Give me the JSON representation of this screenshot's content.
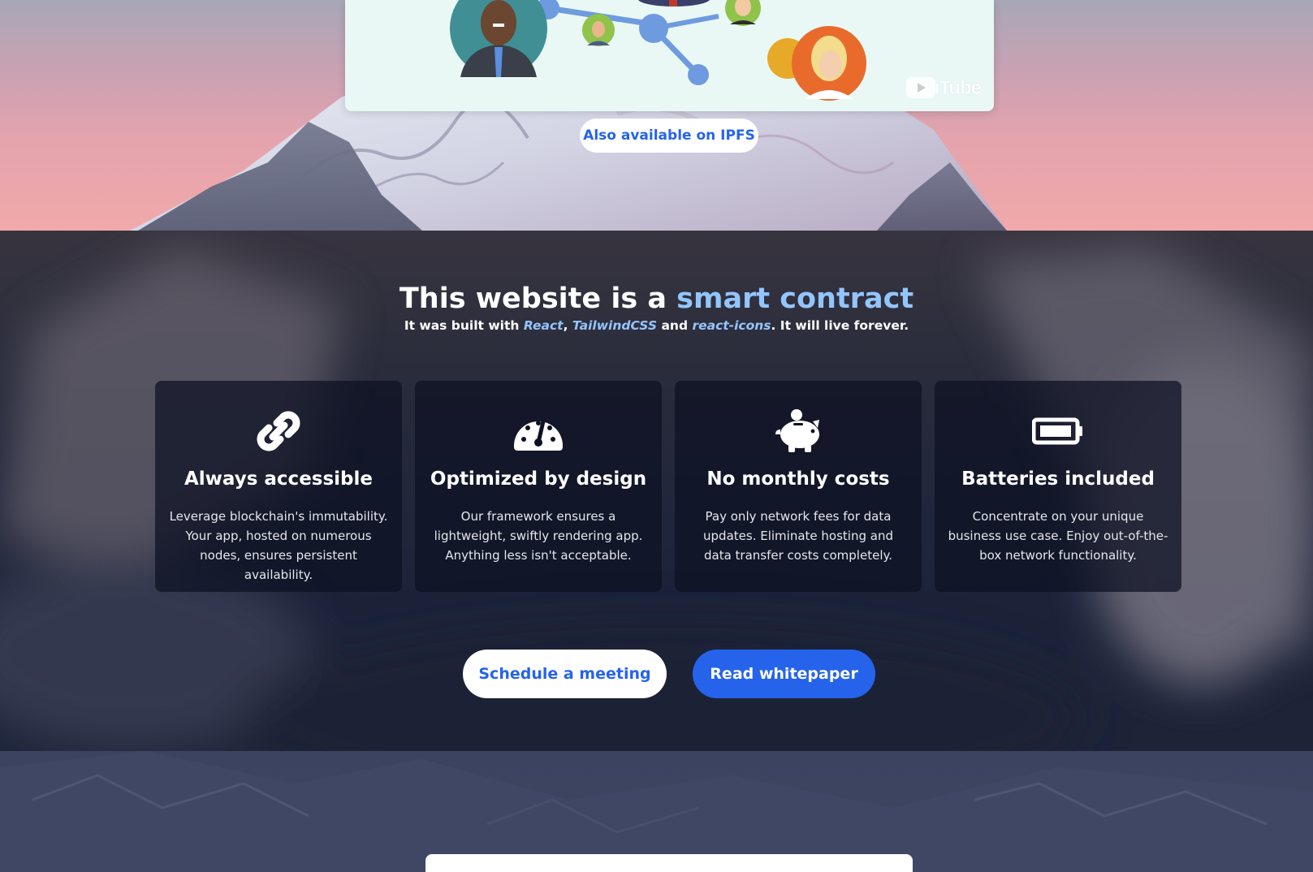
{
  "video": {
    "logo_text": "YouTube",
    "colors": {
      "background": "#e9f8f5",
      "node": "#6e9bdf"
    }
  },
  "hero": {
    "ipfs_label": "Also available on IPFS"
  },
  "band": {
    "title_prefix": "This website is a ",
    "title_accent": "smart contract",
    "subtitle_prefix": "It was built with ",
    "tech_1": "React",
    "sep_1": ", ",
    "tech_2": "TailwindCSS",
    "sep_2": " and ",
    "tech_3": "react-icons",
    "subtitle_suffix": ". It will live forever."
  },
  "features": [
    {
      "icon": "link-icon",
      "title": "Always accessible",
      "text": "Leverage blockchain's immutability. Your app, hosted on numerous nodes, ensures persistent availability."
    },
    {
      "icon": "speedometer-icon",
      "title": "Optimized by design",
      "text": "Our framework ensures a lightweight, swiftly rendering app. Anything less isn't acceptable."
    },
    {
      "icon": "piggy-bank-icon",
      "title": "No monthly costs",
      "text": "Pay only network fees for data updates. Eliminate hosting and data transfer costs completely."
    },
    {
      "icon": "battery-full-icon",
      "title": "Batteries included",
      "text": "Concentrate on your unique business use case. Enjoy out-of-the-box network functionality."
    }
  ],
  "actions": {
    "meeting_label": "Schedule a meeting",
    "whitepaper_label": "Read whitepaper"
  },
  "colors": {
    "accent": "#93c5fd",
    "primary": "#2563eb",
    "card_bg": "#0d1122"
  }
}
